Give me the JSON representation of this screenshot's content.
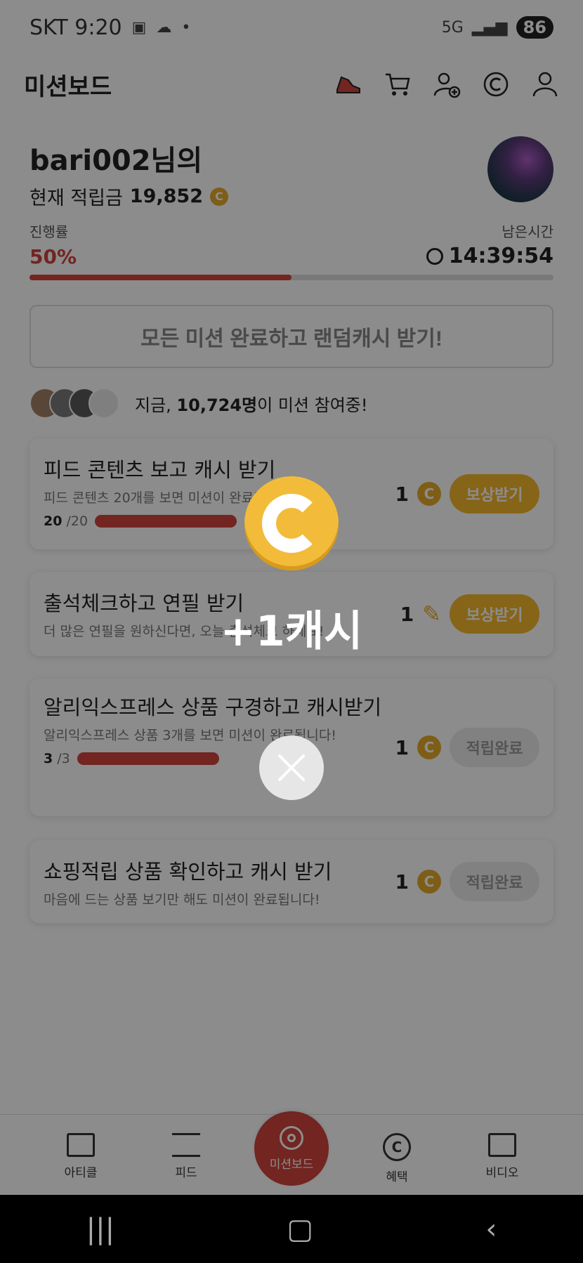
{
  "status_bar": {
    "carrier_time": "SKT 9:20",
    "battery": "86"
  },
  "header": {
    "title": "미션보드"
  },
  "profile": {
    "username": "bari002님의",
    "balance_label": "현재 적립금",
    "balance": "19,852"
  },
  "progress": {
    "label": "진행률",
    "value": "50%",
    "time_label": "남은시간",
    "time": "14:39:54",
    "fraction": 0.5
  },
  "all_missions_button": "모든 미션 완료하고 랜덤캐시 받기!",
  "participants": {
    "prefix": "지금, ",
    "count": "10,724명",
    "suffix": "이 미션 참여중!"
  },
  "missions": [
    {
      "title": "피드 콘텐츠 보고 캐시 받기",
      "desc": "피드 콘텐츠 20개를 보면 미션이 완료됩니다!",
      "progress_cur": "20",
      "progress_total": "/20",
      "reward": "1",
      "button": "보상받기"
    },
    {
      "title": "출석체크하고 연필 받기",
      "desc": "더 많은 연필을 원하신다면, 오늘 출석체크 하세요!",
      "reward": "1",
      "button": "보상받기"
    },
    {
      "title": "알리익스프레스 상품 구경하고 캐시받기",
      "desc": "알리익스프레스 상품 3개를 보면 미션이 완료됩니다!",
      "progress_cur": "3",
      "progress_total": "/3",
      "reward": "1",
      "button": "적립완료"
    },
    {
      "title": "쇼핑적립 상품 확인하고 캐시 받기",
      "desc": "마음에 드는 상품 보기만 해도 미션이 완료됩니다!",
      "reward": "1",
      "button": "적립완료"
    }
  ],
  "tabs": {
    "article": "아티클",
    "feed": "피드",
    "missionboard": "미션보드",
    "benefits": "혜택",
    "video": "비디오"
  },
  "overlay": {
    "reward_text": "+1캐시"
  },
  "colors": {
    "accent": "#d0443c",
    "coin": "#f2bc3a",
    "claim_button": "#f5b82e"
  }
}
